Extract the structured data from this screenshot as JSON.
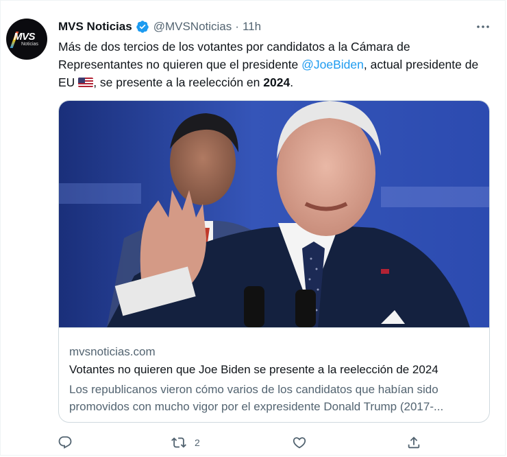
{
  "tweet": {
    "author_name": "MVS Noticias",
    "handle": "@MVSNoticias",
    "separator": "·",
    "time": "11h",
    "avatar": {
      "logo": "MVS",
      "sub": "Noticias"
    },
    "text_before_mention": "Más de dos tercios de los votantes por candidatos a la Cámara de Representantes no quieren que el presidente ",
    "mention": "@JoeBiden",
    "text_after_mention": ", actual presidente de EU ",
    "text_after_flag": ", se presente a la reelección en ",
    "bold_year": "2024",
    "end_punct": "."
  },
  "card": {
    "domain": "mvsnoticias.com",
    "title": "Votantes no quieren que Joe Biden se presente a la reelección de 2024",
    "description": "Los republicanos vieron cómo varios de los candidatos que habían sido promovidos con mucho vigor por el expresidente Donald Trump (2017-..."
  },
  "actions": {
    "reply_count": "",
    "retweet_count": "2",
    "like_count": ""
  },
  "icons": [
    "verified-badge-icon",
    "more-options-icon",
    "reply-icon",
    "retweet-icon",
    "like-icon",
    "share-icon",
    "us-flag-emoji"
  ],
  "colors": {
    "accent": "#1d9bf0",
    "secondary_text": "#536471",
    "border": "#cfd9de"
  }
}
